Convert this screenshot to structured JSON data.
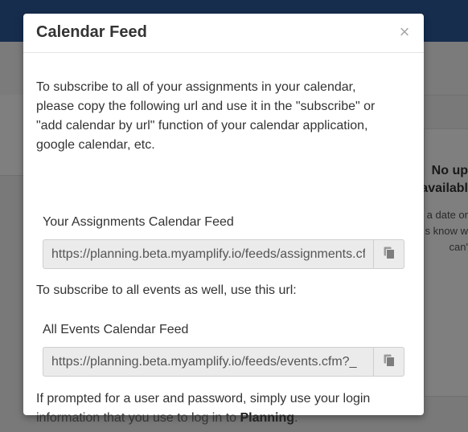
{
  "background": {
    "empty_state_title": "No up",
    "empty_state_title_line2": "availabl",
    "empty_state_lines": [
      "a date or",
      "s know w",
      "can'"
    ]
  },
  "modal": {
    "title": "Calendar Feed",
    "close_label": "×",
    "intro": "To subscribe to all of your assignments in your calendar, please copy the following url and use it in the \"subscribe\" or \"add calendar by url\" function of your calendar application, google calendar, etc.",
    "assignments_feed": {
      "label": "Your Assignments Calendar Feed",
      "url": "https://planning.beta.myamplify.io/feeds/assignments.cfm?_"
    },
    "all_events_text": "To subscribe to all events as well, use this url:",
    "events_feed": {
      "label": "All Events Calendar Feed",
      "url": "https://planning.beta.myamplify.io/feeds/events.cfm?_"
    },
    "footer_prefix": "If prompted for a user and password, simply use your login information that you use to log in to ",
    "footer_app_name": "Planning",
    "footer_suffix": "."
  },
  "icons": {
    "copy": "copy-icon"
  },
  "colors": {
    "topbar": "#2d5b9c",
    "overlay": "rgba(0,0,0,0.5)"
  }
}
